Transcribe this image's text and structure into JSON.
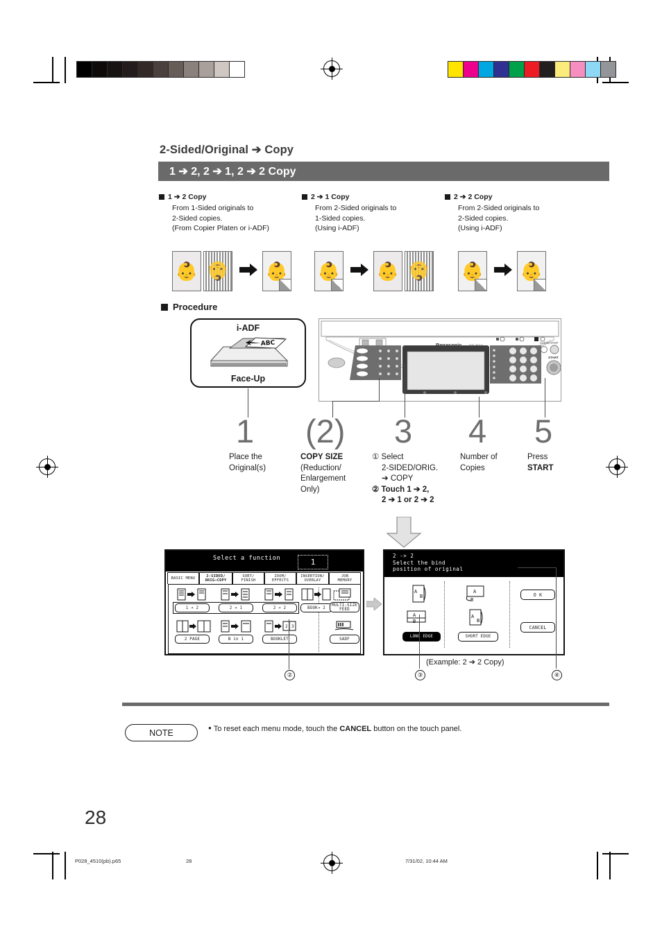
{
  "document": {
    "section_title": "2-Sided/Original ➔ Copy",
    "banner": "1 ➔ 2, 2 ➔ 1, 2 ➔ 2 Copy",
    "page_number": "28",
    "footer": {
      "file": "P028_4510(pb).p65",
      "page": "28",
      "timestamp": "7/31/02, 10:44 AM"
    }
  },
  "modes": [
    {
      "heading": "1 ➔ 2 Copy",
      "lines": [
        "From 1-Sided originals to",
        "2-Sided copies.",
        "(From Copier Platen or i-ADF)"
      ]
    },
    {
      "heading": "2 ➔ 1 Copy",
      "lines": [
        "From 2-Sided originals to",
        "1-Sided copies.",
        "(Using i-ADF)"
      ]
    },
    {
      "heading": "2 ➔ 2 Copy",
      "lines": [
        "From 2-Sided originals to",
        "2-Sided copies.",
        "(Using i-ADF)"
      ]
    }
  ],
  "procedure": {
    "heading": "Procedure",
    "iadf": {
      "top_label": "i-ADF",
      "bottom_label": "Face-Up",
      "page_text": "ABC"
    },
    "panel_brand": "Panasonic",
    "steps": [
      {
        "num": "1",
        "caption_lines": [
          "Place the",
          "Original(s)"
        ]
      },
      {
        "num": "(2)",
        "caption_lines": [
          "COPY SIZE",
          "(Reduction/",
          "Enlargement",
          "Only)"
        ],
        "bold_first": true
      },
      {
        "num": "3",
        "caption_lines": [
          "① Select",
          "2-SIDED/ORIG.",
          "➔ COPY",
          "② Touch 1 ➔ 2,",
          "2 ➔ 1 or 2 ➔ 2"
        ]
      },
      {
        "num": "4",
        "caption_lines": [
          "Number of",
          "Copies"
        ]
      },
      {
        "num": "5",
        "caption_lines": [
          "Press",
          "START"
        ],
        "bold_last": true
      }
    ]
  },
  "lcd_left": {
    "title": "Select a function",
    "counter": "1",
    "tabs": [
      {
        "lines": [
          "BASIC MENU"
        ],
        "selected": false
      },
      {
        "lines": [
          "2-SIDED/",
          "ORIG➔COPY"
        ],
        "selected": true
      },
      {
        "lines": [
          "SORT/",
          "FINISH"
        ],
        "selected": false
      },
      {
        "lines": [
          "ZOOM/",
          "EFFECTS"
        ],
        "selected": false
      },
      {
        "lines": [
          "INSERTION/",
          "OVERLAY"
        ],
        "selected": false
      },
      {
        "lines": [
          "JOB",
          "MEMORY"
        ],
        "selected": false
      }
    ],
    "buttons_row1": [
      "1 ➔ 2",
      "2 ➔ 1",
      "2 ➔ 2",
      "BOOK➔ 2"
    ],
    "buttons_row2": [
      "2 PAGE",
      "N in 1",
      "BOOKLET"
    ],
    "buttons_right": [
      "MULTI-SIZE FEED",
      "SADF"
    ],
    "marker": "②"
  },
  "lcd_right": {
    "title_lines": [
      "2 -> 2",
      "Select the bind",
      "position of original"
    ],
    "bind_buttons": [
      {
        "label": "LONG EDGE",
        "selected": true
      },
      {
        "label": "SHORT EDGE",
        "selected": false
      }
    ],
    "action_buttons": [
      {
        "label": "O K"
      },
      {
        "label": "CANCEL"
      }
    ],
    "page_letters": [
      "A",
      "B"
    ],
    "caption": "(Example: 2 ➔ 2 Copy)",
    "markers": [
      "③",
      "④"
    ]
  },
  "note": {
    "label": "NOTE",
    "bullet": "●",
    "text_before": "To reset each menu mode, touch the ",
    "text_bold": "CANCEL",
    "text_after": " button on the touch panel."
  },
  "colors": {
    "banner_bg": "#6a6a6a",
    "step_number": "#6e6e6e",
    "rule": "#6a6a6a",
    "gray_bar": [
      "#000000",
      "#0d0a0a",
      "#181313",
      "#241c1c",
      "#332a28",
      "#4a403d",
      "#665c58",
      "#8a817c",
      "#a9a09b",
      "#cfc7c2",
      "#ffffff"
    ],
    "color_bar": [
      "#ffe400",
      "#ec008c",
      "#00a7e1",
      "#2e3192",
      "#00a14b",
      "#ed1c24",
      "#231f20",
      "#fbeb7a",
      "#f happy",
      "#8fd8f5",
      "#939598"
    ],
    "color_bar_fixed": [
      "#ffe400",
      "#ec008c",
      "#00a7e1",
      "#2e3192",
      "#00a14b",
      "#ed1c24",
      "#231f20",
      "#fbeb7a",
      "#f68fc0",
      "#8fd8f5",
      "#939598"
    ]
  }
}
